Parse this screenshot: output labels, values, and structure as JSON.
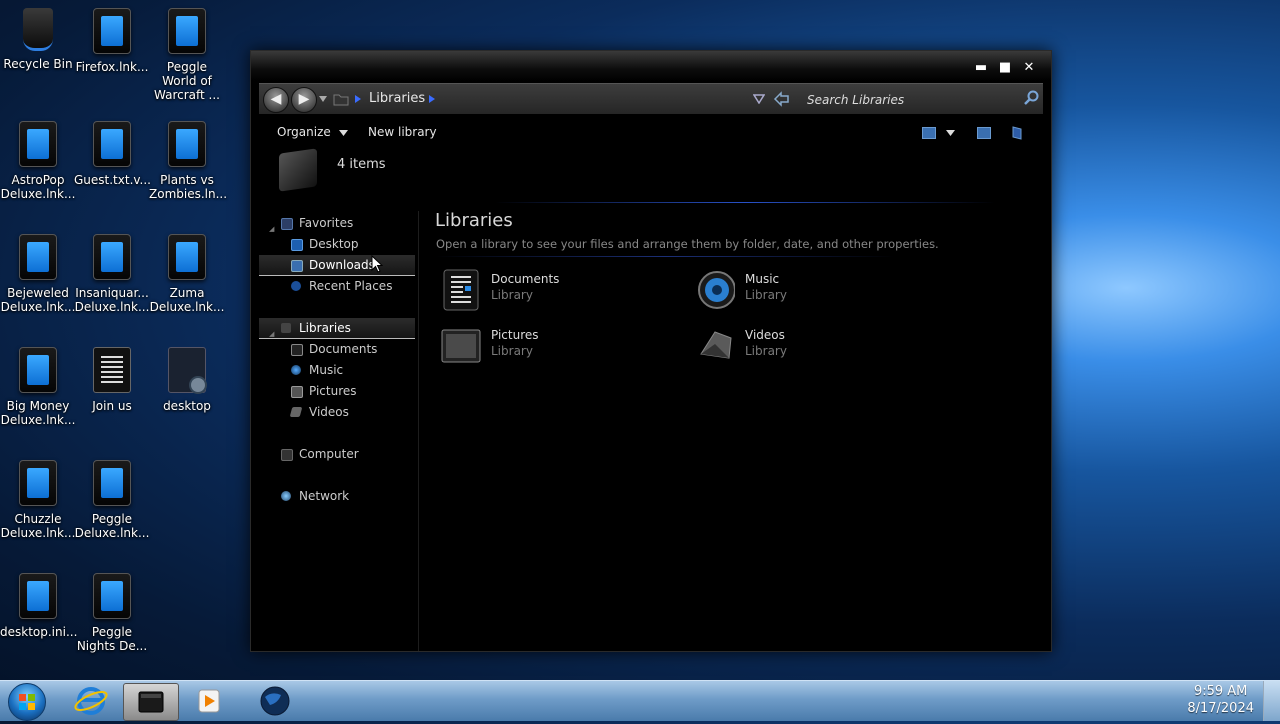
{
  "desktop": {
    "icons": [
      {
        "label": "Recycle Bin",
        "icon": "recycle-bin-icon"
      },
      {
        "label": "Firefox.lnk...",
        "icon": "shortcut-icon"
      },
      {
        "label": "Peggle World of Warcraft ...",
        "icon": "shortcut-icon"
      },
      {
        "label": "AstroPop Deluxe.lnk...",
        "icon": "shortcut-icon"
      },
      {
        "label": "Guest.txt.v...",
        "icon": "shortcut-icon"
      },
      {
        "label": "Plants vs Zombies.ln...",
        "icon": "shortcut-icon"
      },
      {
        "label": "Bejeweled Deluxe.lnk...",
        "icon": "shortcut-icon"
      },
      {
        "label": "Insaniquar... Deluxe.lnk...",
        "icon": "shortcut-icon"
      },
      {
        "label": "Zuma Deluxe.lnk...",
        "icon": "shortcut-icon"
      },
      {
        "label": "Big Money Deluxe.lnk...",
        "icon": "shortcut-icon"
      },
      {
        "label": "Join us",
        "icon": "text-file-icon"
      },
      {
        "label": "desktop",
        "icon": "config-file-icon"
      },
      {
        "label": "Chuzzle Deluxe.lnk...",
        "icon": "shortcut-icon"
      },
      {
        "label": "Peggle Deluxe.lnk...",
        "icon": "shortcut-icon"
      },
      {
        "label": "desktop.ini...",
        "icon": "shortcut-icon"
      },
      {
        "label": "Peggle Nights De...",
        "icon": "shortcut-icon"
      }
    ]
  },
  "window": {
    "caption_buttons": {
      "minimize": "▬",
      "maximize": "■",
      "close": "✕"
    },
    "address": {
      "back_glyph": "◀",
      "forward_glyph": "▶",
      "breadcrumb": "Libraries",
      "search_placeholder": "Search Libraries"
    },
    "toolbar": {
      "organize": "Organize",
      "new_library": "New library"
    },
    "details": {
      "item_count": "4 items"
    },
    "nav": {
      "favorites": "Favorites",
      "desktop": "Desktop",
      "downloads": "Downloads",
      "recent_places": "Recent Places",
      "libraries": "Libraries",
      "documents": "Documents",
      "music": "Music",
      "pictures": "Pictures",
      "videos": "Videos",
      "computer": "Computer",
      "network": "Network"
    },
    "content": {
      "title": "Libraries",
      "subtitle": "Open a library to see your files and arrange them by folder, date, and other properties.",
      "items": [
        {
          "name": "Documents",
          "kind": "Library"
        },
        {
          "name": "Music",
          "kind": "Library"
        },
        {
          "name": "Pictures",
          "kind": "Library"
        },
        {
          "name": "Videos",
          "kind": "Library"
        }
      ]
    }
  },
  "taskbar": {
    "time": "9:59 AM",
    "date": "8/17/2024"
  }
}
